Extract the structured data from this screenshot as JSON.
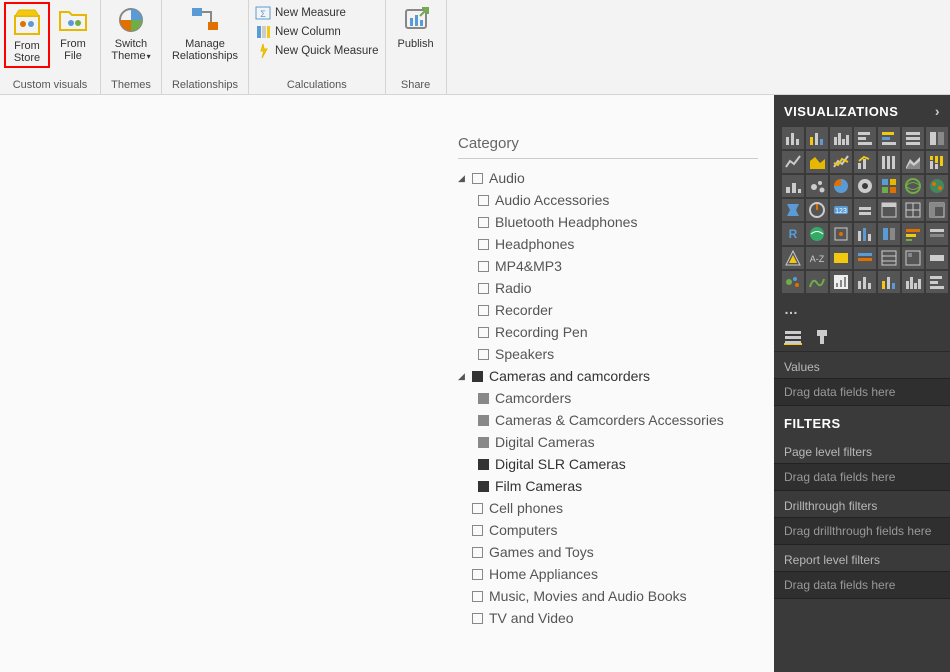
{
  "ribbon": {
    "groups": [
      {
        "label": "Custom visuals",
        "buttons": [
          {
            "id": "from-store",
            "line1": "From",
            "line2": "Store"
          },
          {
            "id": "from-file",
            "line1": "From",
            "line2": "File"
          }
        ]
      },
      {
        "label": "Themes",
        "buttons": [
          {
            "id": "switch-theme",
            "line1": "Switch",
            "line2": "Theme",
            "hasDropdown": true
          }
        ]
      },
      {
        "label": "Relationships",
        "buttons": [
          {
            "id": "manage-relationships",
            "line1": "Manage",
            "line2": "Relationships"
          }
        ]
      },
      {
        "label": "Calculations",
        "small": [
          {
            "id": "new-measure",
            "label": "New Measure"
          },
          {
            "id": "new-column",
            "label": "New Column"
          },
          {
            "id": "new-quick-measure",
            "label": "New Quick Measure"
          }
        ]
      },
      {
        "label": "Share",
        "buttons": [
          {
            "id": "publish",
            "line1": "Publish",
            "line2": ""
          }
        ]
      }
    ]
  },
  "slicer": {
    "title": "Category",
    "tree": [
      {
        "label": "Audio",
        "state": "empty",
        "expanded": true,
        "children": [
          {
            "label": "Audio Accessories",
            "state": "empty"
          },
          {
            "label": "Bluetooth Headphones",
            "state": "empty"
          },
          {
            "label": "Headphones",
            "state": "empty"
          },
          {
            "label": "MP4&MP3",
            "state": "empty"
          },
          {
            "label": "Radio",
            "state": "empty"
          },
          {
            "label": "Recorder",
            "state": "empty"
          },
          {
            "label": "Recording Pen",
            "state": "empty"
          },
          {
            "label": "Speakers",
            "state": "empty"
          }
        ]
      },
      {
        "label": "Cameras and camcorders",
        "state": "filled",
        "expanded": true,
        "children": [
          {
            "label": "Camcorders",
            "state": "filled-light"
          },
          {
            "label": "Cameras & Camcorders Accessories",
            "state": "filled-light"
          },
          {
            "label": "Digital Cameras",
            "state": "filled-light"
          },
          {
            "label": "Digital SLR Cameras",
            "state": "filled"
          },
          {
            "label": "Film Cameras",
            "state": "filled"
          }
        ]
      },
      {
        "label": "Cell phones",
        "state": "empty",
        "expanded": false
      },
      {
        "label": "Computers",
        "state": "empty",
        "expanded": false
      },
      {
        "label": "Games and Toys",
        "state": "empty",
        "expanded": false
      },
      {
        "label": "Home Appliances",
        "state": "empty",
        "expanded": false
      },
      {
        "label": "Music, Movies and Audio Books",
        "state": "empty",
        "expanded": false
      },
      {
        "label": "TV and Video",
        "state": "empty",
        "expanded": false
      }
    ]
  },
  "panels": {
    "viz_header": "VISUALIZATIONS",
    "filters_header": "FILTERS",
    "values_label": "Values",
    "values_placeholder": "Drag data fields here",
    "filters": [
      {
        "label": "Page level filters",
        "placeholder": "Drag data fields here"
      },
      {
        "label": "Drillthrough filters",
        "placeholder": "Drag drillthrough fields here"
      },
      {
        "label": "Report level filters",
        "placeholder": "Drag data fields here"
      }
    ],
    "dots": "…"
  }
}
